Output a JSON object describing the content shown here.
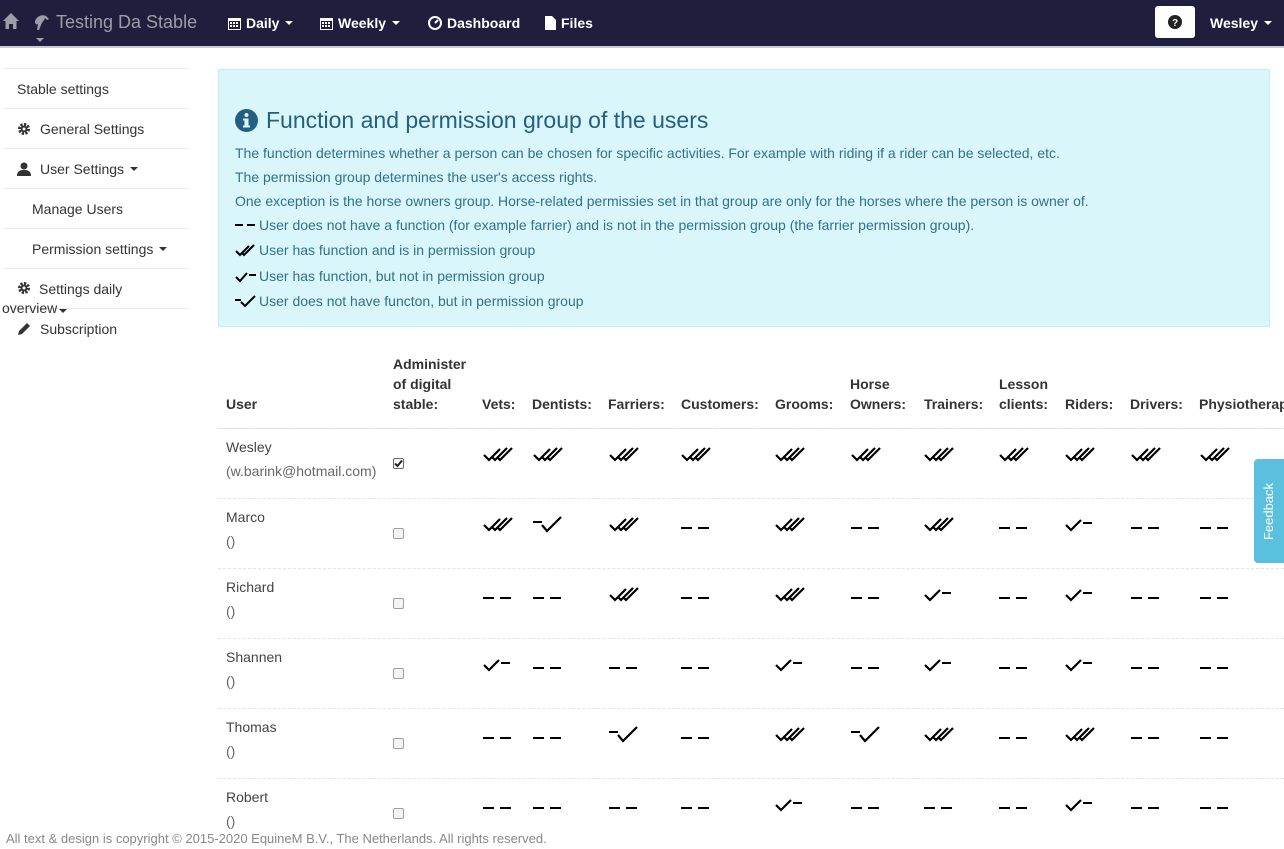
{
  "nav": {
    "brand": "Testing Da Stable",
    "items": [
      {
        "label": "Daily",
        "icon": "calendar-icon",
        "dropdown": true
      },
      {
        "label": "Weekly",
        "icon": "calendar-icon",
        "dropdown": true
      },
      {
        "label": "Dashboard",
        "icon": "dashboard-icon",
        "dropdown": false
      },
      {
        "label": "Files",
        "icon": "file-icon",
        "dropdown": false
      }
    ],
    "user": "Wesley"
  },
  "sidebar": {
    "items": [
      {
        "label": "Stable settings",
        "icon": ""
      },
      {
        "label": "General Settings",
        "icon": "gear-icon"
      },
      {
        "label": "User Settings",
        "icon": "user-icon"
      },
      {
        "label": "Manage Users",
        "icon": ""
      },
      {
        "label": "Permission settings",
        "icon": ""
      },
      {
        "label": "Settings daily",
        "label2": "overview",
        "icon": "gear-icon"
      },
      {
        "label": "Subscription",
        "icon": "pencil-icon"
      }
    ]
  },
  "info": {
    "title": "Function and permission group of the users",
    "lines": [
      "The function determines whether a person can be chosen for specific activities. For example with riding if a rider can be selected, etc.",
      "The permission group determines the user's access rights.",
      "One exception is the horse owners group. Horse-related permissies set in that group are only for the horses where the person is owner of."
    ],
    "legend": [
      {
        "symbol": "none",
        "text": "User does not have a function (for example farrier) and is not in the permission group (the farrier permission group)."
      },
      {
        "symbol": "both",
        "text": "User has function and is in permission group"
      },
      {
        "symbol": "function",
        "text": "User has function, but not in permission group"
      },
      {
        "symbol": "permission",
        "text": "User does not have functon, but in permission group"
      }
    ]
  },
  "table": {
    "headers": {
      "user": "User",
      "admin": [
        "Administer",
        "of digital",
        "stable:"
      ],
      "columns": [
        [
          "Vets:"
        ],
        [
          "Dentists:"
        ],
        [
          "Farriers:"
        ],
        [
          "Customers:"
        ],
        [
          "Grooms:"
        ],
        [
          "Horse",
          "Owners:"
        ],
        [
          "Trainers:"
        ],
        [
          "Lesson",
          "clients:"
        ],
        [
          "Riders:"
        ],
        [
          "Drivers:"
        ],
        [
          "Physiotherapists:"
        ]
      ]
    },
    "rows": [
      {
        "name": "Wesley",
        "email": "(w.barink@hotmail.com)",
        "admin": true,
        "cells": [
          "both",
          "both",
          "both",
          "both",
          "both",
          "both",
          "both",
          "both",
          "both",
          "both",
          "both"
        ]
      },
      {
        "name": "Marco",
        "email": "()",
        "admin": false,
        "cells": [
          "both",
          "permission",
          "both",
          "none",
          "both",
          "none",
          "both",
          "none",
          "function",
          "none",
          "none"
        ]
      },
      {
        "name": "Richard",
        "email": "()",
        "admin": false,
        "cells": [
          "none",
          "none",
          "both",
          "none",
          "both",
          "none",
          "function",
          "none",
          "function",
          "none",
          "none"
        ]
      },
      {
        "name": "Shannen",
        "email": "()",
        "admin": false,
        "cells": [
          "function",
          "none",
          "none",
          "none",
          "function",
          "none",
          "function",
          "none",
          "function",
          "none",
          "none"
        ]
      },
      {
        "name": "Thomas",
        "email": "()",
        "admin": false,
        "cells": [
          "none",
          "none",
          "permission",
          "none",
          "both",
          "permission",
          "both",
          "none",
          "both",
          "none",
          "none"
        ]
      },
      {
        "name": "Robert",
        "email": "()",
        "admin": false,
        "cells": [
          "none",
          "none",
          "none",
          "none",
          "function",
          "none",
          "none",
          "none",
          "function",
          "none",
          "none"
        ]
      }
    ]
  },
  "feedback": "Feedback",
  "footer": "All text & design is copyright © 2015-2020 EquineM B.V., The Netherlands. All rights reserved."
}
